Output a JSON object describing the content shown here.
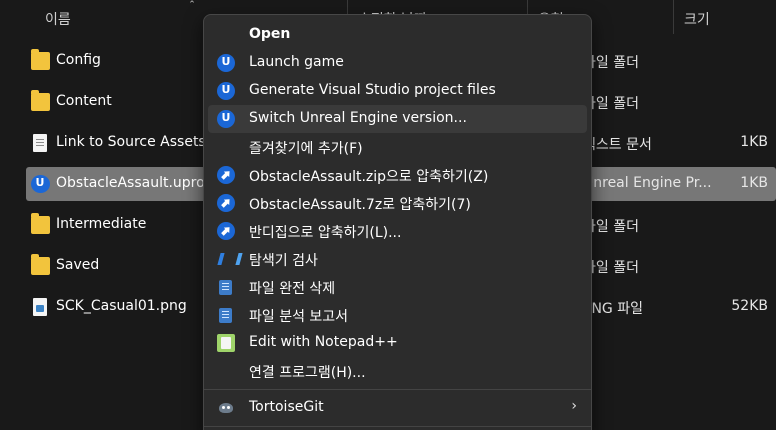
{
  "columns": {
    "name": "이름",
    "modified": "수정한 날짜",
    "type": "유형",
    "size": "크기"
  },
  "files": [
    {
      "name": "Config",
      "icon": "folder-icon",
      "type": "파일 폴더",
      "size": ""
    },
    {
      "name": "Content",
      "icon": "folder-icon",
      "type": "파일 폴더",
      "size": ""
    },
    {
      "name": "Link to Source Assets.txt",
      "icon": "text-file-icon",
      "type": "텍스트 문서",
      "size": "1KB"
    },
    {
      "name": "ObstacleAssault.uproject",
      "icon": "unreal-engine-icon",
      "type": "Unreal Engine Pr...",
      "size": "1KB",
      "selected": true
    },
    {
      "name": "Intermediate",
      "icon": "folder-icon",
      "type": "파일 폴더",
      "size": ""
    },
    {
      "name": "Saved",
      "icon": "folder-icon",
      "type": "파일 폴더",
      "size": ""
    },
    {
      "name": "SCK_Casual01.png",
      "icon": "png-file-icon",
      "type": "PNG 파일",
      "size": "52KB"
    }
  ],
  "context_menu": {
    "items": [
      {
        "label": "Open",
        "icon": "",
        "bold": true
      },
      {
        "label": "Launch game",
        "icon": "unreal-engine-icon"
      },
      {
        "label": "Generate Visual Studio project files",
        "icon": "unreal-engine-icon"
      },
      {
        "label": "Switch Unreal Engine version...",
        "icon": "unreal-engine-icon",
        "hover": true
      },
      {
        "label": "즐겨찾기에 추가(F)",
        "icon": ""
      },
      {
        "label": "ObstacleAssault.zip으로 압축하기(Z)",
        "icon": "bandizip-icon"
      },
      {
        "label": "ObstacleAssault.7z로 압축하기(7)",
        "icon": "bandizip-icon"
      },
      {
        "label": "반디집으로 압축하기(L)...",
        "icon": "bandizip-icon"
      },
      {
        "label": "탐색기 검사",
        "icon": "v3-scan-icon"
      },
      {
        "label": "파일 완전 삭제",
        "icon": "shredder-icon"
      },
      {
        "label": "파일 분석 보고서",
        "icon": "analysis-report-icon"
      },
      {
        "label": "Edit with Notepad++",
        "icon": "notepad-plus-plus-icon"
      },
      {
        "label": "연결 프로그램(H)...",
        "icon": ""
      }
    ],
    "submenu_items": [
      {
        "label": "TortoiseGit",
        "icon": "tortoisegit-icon",
        "chevron": "›"
      }
    ]
  },
  "colors": {
    "background": "#191919",
    "selected_row": "#777777",
    "menu_bg": "#2c2c2c",
    "menu_hover": "#3a3a3a",
    "folder": "#f2c43d",
    "unreal_blue": "#1b67d6"
  }
}
